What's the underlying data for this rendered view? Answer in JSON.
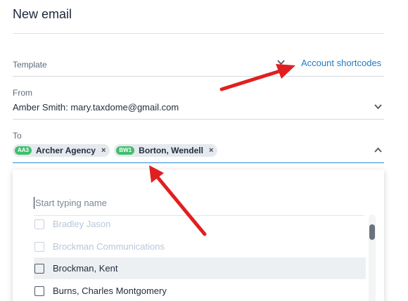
{
  "title": "New email",
  "template": {
    "label": "Template",
    "shortcodes_link": "Account shortcodes"
  },
  "from": {
    "label": "From",
    "value": "Amber Smith: mary.taxdome@gmail.com"
  },
  "to": {
    "label": "To",
    "chips": [
      {
        "badge": "AA3",
        "label": "Archer Agency",
        "remove": "×"
      },
      {
        "badge": "BW1",
        "label": "Borton, Wendell",
        "remove": "×"
      }
    ]
  },
  "dropdown": {
    "search_placeholder": "Start typing name",
    "options": [
      {
        "label": "Bradley Jason",
        "state": "disabled"
      },
      {
        "label": "Brockman Communications",
        "state": "disabled"
      },
      {
        "label": "Brockman, Kent",
        "state": "hover"
      },
      {
        "label": "Burns, Charles Montgomery",
        "state": "normal"
      }
    ]
  },
  "colors": {
    "link": "#1f7ac8",
    "badge": "#3fbf6e",
    "annotation_arrow": "#e02020",
    "active_rule": "#2b8bd3"
  }
}
